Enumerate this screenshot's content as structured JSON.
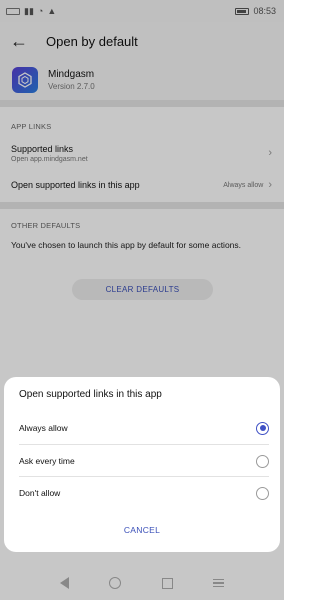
{
  "status_bar": {
    "time": "08:53"
  },
  "app_bar": {
    "title": "Open by default"
  },
  "app": {
    "name": "Mindgasm",
    "version": "Version 2.7.0"
  },
  "app_links": {
    "header": "APP LINKS",
    "supported_links": {
      "title": "Supported links",
      "subtitle": "Open app.mindgasm.net"
    },
    "open_supported": {
      "title": "Open supported links in this app",
      "value": "Always allow"
    }
  },
  "other_defaults": {
    "header": "OTHER DEFAULTS",
    "description": "You've chosen to launch this app by default for some actions.",
    "clear_button": "CLEAR DEFAULTS"
  },
  "dialog": {
    "title": "Open supported links in this app",
    "options": [
      {
        "label": "Always allow",
        "selected": true
      },
      {
        "label": "Ask every time",
        "selected": false
      },
      {
        "label": "Don't allow",
        "selected": false
      }
    ],
    "cancel": "CANCEL"
  },
  "colors": {
    "accent": "#3f51c5"
  },
  "icons": [
    "back-arrow-icon",
    "chevron-right-icon",
    "radio-icon",
    "nav-back-icon",
    "nav-home-icon",
    "nav-recent-icon",
    "nav-menu-icon"
  ]
}
